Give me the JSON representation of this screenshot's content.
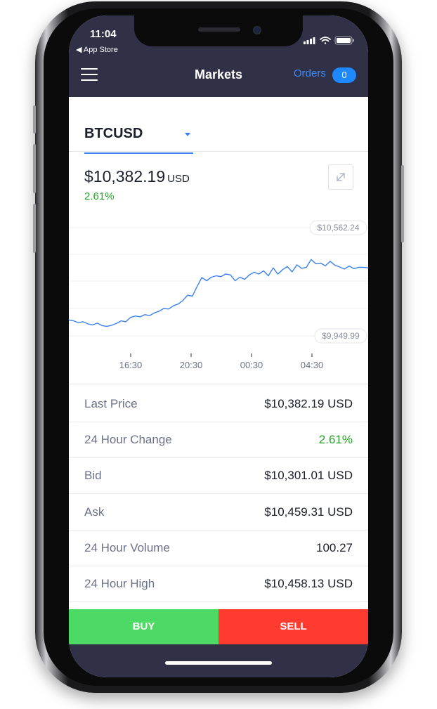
{
  "status_bar": {
    "time": "11:04",
    "back_app": "◀ App Store"
  },
  "nav": {
    "title": "Markets",
    "orders_label": "Orders",
    "orders_count": "0"
  },
  "market": {
    "pair": "BTCUSD",
    "price": "$10,382.19",
    "currency": "USD",
    "change": "2.61%"
  },
  "chart_data": {
    "type": "line",
    "high_label": "$10,562.24",
    "low_label": "$9,949.99",
    "x_ticks": [
      "16:30",
      "20:30",
      "00:30",
      "04:30"
    ],
    "ylim": [
      9949.99,
      10562.24
    ],
    "series": [
      {
        "values": [
          10040,
          10035,
          10025,
          10030,
          10018,
          10012,
          10022,
          10008,
          10004,
          10010,
          10020,
          10035,
          10030,
          10055,
          10062,
          10058,
          10070,
          10065,
          10080,
          10090,
          10105,
          10102,
          10120,
          10130,
          10150,
          10180,
          10175,
          10230,
          10280,
          10262,
          10282,
          10290,
          10285,
          10300,
          10295,
          10262,
          10282,
          10270,
          10295,
          10310,
          10300,
          10318,
          10290,
          10335,
          10300,
          10325,
          10342,
          10312,
          10352,
          10332,
          10338,
          10382,
          10358,
          10362,
          10346,
          10372,
          10350,
          10340,
          10328,
          10345,
          10330,
          10338,
          10338,
          10335
        ]
      }
    ],
    "colors": {
      "line": "#3b82f0"
    }
  },
  "stats": [
    {
      "label": "Last Price",
      "value": "$10,382.19 USD"
    },
    {
      "label": "24 Hour Change",
      "value": "2.61%"
    },
    {
      "label": "Bid",
      "value": "$10,301.01 USD"
    },
    {
      "label": "Ask",
      "value": "$10,459.31 USD"
    },
    {
      "label": "24 Hour Volume",
      "value": "100.27"
    },
    {
      "label": "24 Hour High",
      "value": "$10,458.13 USD"
    }
  ],
  "actions": {
    "buy": "BUY",
    "sell": "SELL"
  },
  "icons": [
    "hamburger-menu-icon",
    "signal-icon",
    "wifi-icon",
    "battery-icon",
    "expand-icon",
    "dropdown-caret-icon"
  ]
}
